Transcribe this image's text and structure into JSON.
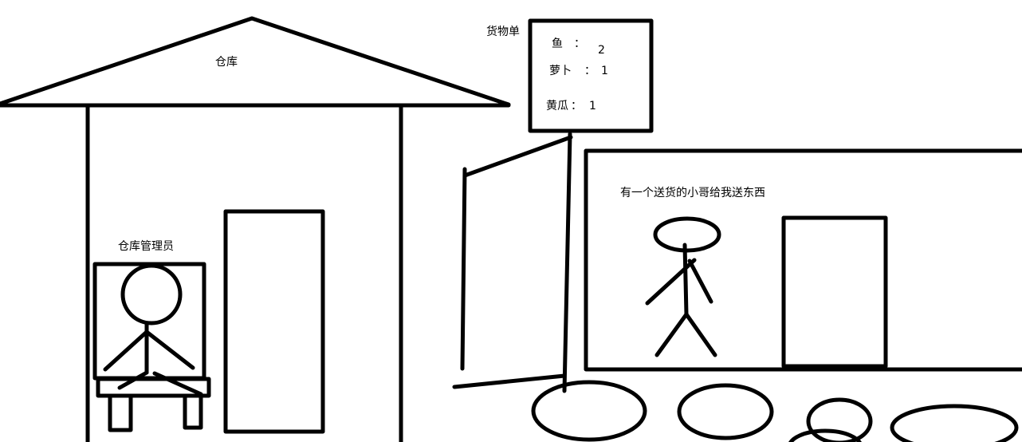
{
  "warehouse": {
    "title": "仓库",
    "keeper_label": "仓库管理员"
  },
  "cargo_list": {
    "title": "货物单",
    "items": [
      {
        "name": "鱼",
        "sep": "：",
        "count": "2"
      },
      {
        "name": "萝卜",
        "sep": "：",
        "count": "1"
      },
      {
        "name": "黄瓜",
        "sep": "：",
        "count": "1"
      }
    ]
  },
  "truck": {
    "caption": "有一个送货的小哥给我送东西"
  },
  "colors": {
    "stroke": "#000000",
    "background": "#ffffff"
  }
}
